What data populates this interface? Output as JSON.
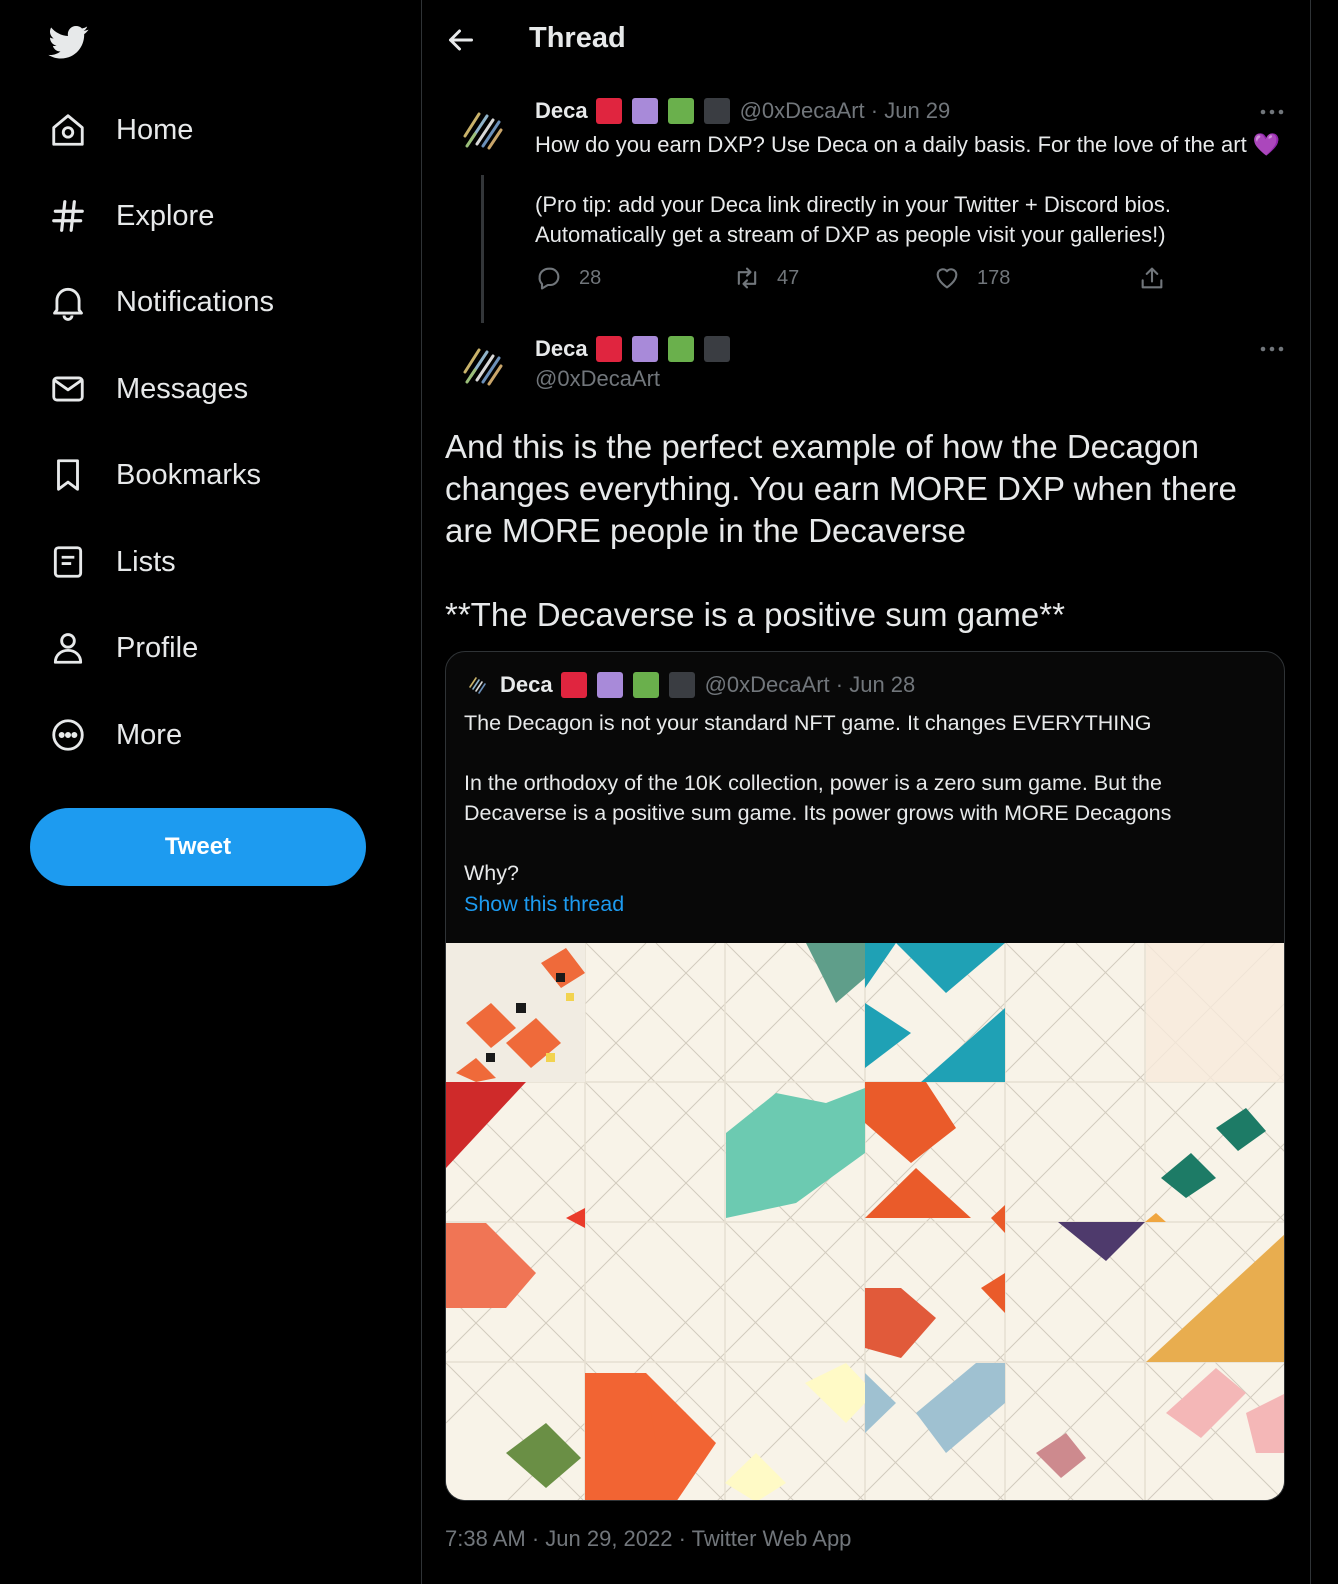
{
  "sidebar": {
    "logo_icon": "twitter-bird-icon",
    "nav": [
      {
        "label": "Home",
        "icon": "home-icon"
      },
      {
        "label": "Explore",
        "icon": "hashtag-icon"
      },
      {
        "label": "Notifications",
        "icon": "bell-icon"
      },
      {
        "label": "Messages",
        "icon": "envelope-icon"
      },
      {
        "label": "Bookmarks",
        "icon": "bookmark-icon"
      },
      {
        "label": "Lists",
        "icon": "list-icon"
      },
      {
        "label": "Profile",
        "icon": "person-icon"
      },
      {
        "label": "More",
        "icon": "more-circle-icon"
      }
    ],
    "tweet_button": "Tweet"
  },
  "header": {
    "title": "Thread"
  },
  "parent_tweet": {
    "name": "Deca",
    "badge_colors": [
      "#e0253f",
      "#a88ad9",
      "#6ab04c",
      "#3a3d42"
    ],
    "handle": "@0xDecaArt",
    "separator": " · ",
    "date": "Jun 29",
    "text": "How do you earn DXP? Use Deca on a daily basis. For the love of the art 💜\n\n(Pro tip: add your Deca link directly in your Twitter + Discord bios. Automatically get a stream of DXP as people visit your galleries!)",
    "replies": "28",
    "retweets": "47",
    "likes": "178"
  },
  "main_tweet": {
    "name": "Deca",
    "handle": "@0xDecaArt",
    "text_p1": "And this is the perfect example of how the Decagon changes everything. You earn MORE DXP when there are MORE people in the Decaverse",
    "text_p2": "**The Decaverse is a positive sum game**",
    "timestamp": "7:38 AM · Jun 29, 2022 · Twitter Web App"
  },
  "quoted_tweet": {
    "name": "Deca",
    "handle": "@0xDecaArt",
    "separator": " · ",
    "date": "Jun 28",
    "text": "The Decagon is not your standard NFT game. It changes EVERYTHING\n\nIn the orthodoxy of the 10K collection, power is a zero sum game. But the Decaverse is a positive sum game. Its power grows with MORE Decagons\n\nWhy?",
    "link": "Show this thread"
  },
  "colors": {
    "accent": "#1d9bf0",
    "text": "#e7e9ea",
    "muted": "#71767b",
    "border": "#2f3336"
  }
}
